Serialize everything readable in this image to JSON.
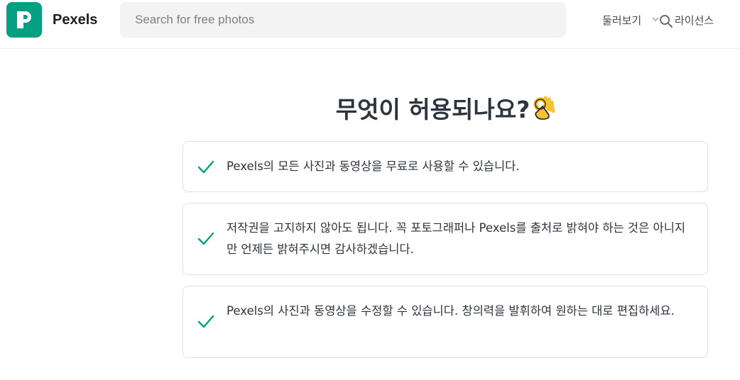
{
  "header": {
    "brand": "Pexels",
    "search_placeholder": "Search for free photos",
    "nav_explore": "둘러보기",
    "nav_license": "라이선스"
  },
  "main": {
    "heading": "무엇이 허용되나요?",
    "items": [
      "Pexels의 모든 사진과 동영상을 무료로 사용할 수 있습니다.",
      "저작권을 고지하지 않아도 됩니다. 꼭 포토그래퍼나 Pexels를 출처로 밝혀야 하는 것은 아니지만 언제든 밝혀주시면 감사하겠습니다.",
      "Pexels의 사진과 동영상을 수정할 수 있습니다. 창의력을 발휘하여 원하는 대로 편집하세요."
    ]
  },
  "colors": {
    "brand_green": "#05a081",
    "check": "#05a081",
    "text": "#2c343e",
    "border": "#dfdfe0"
  },
  "icons": [
    "pexels-logo-icon",
    "search-icon",
    "chevron-down-icon",
    "ok-hand-icon",
    "checkmark-icon"
  ]
}
